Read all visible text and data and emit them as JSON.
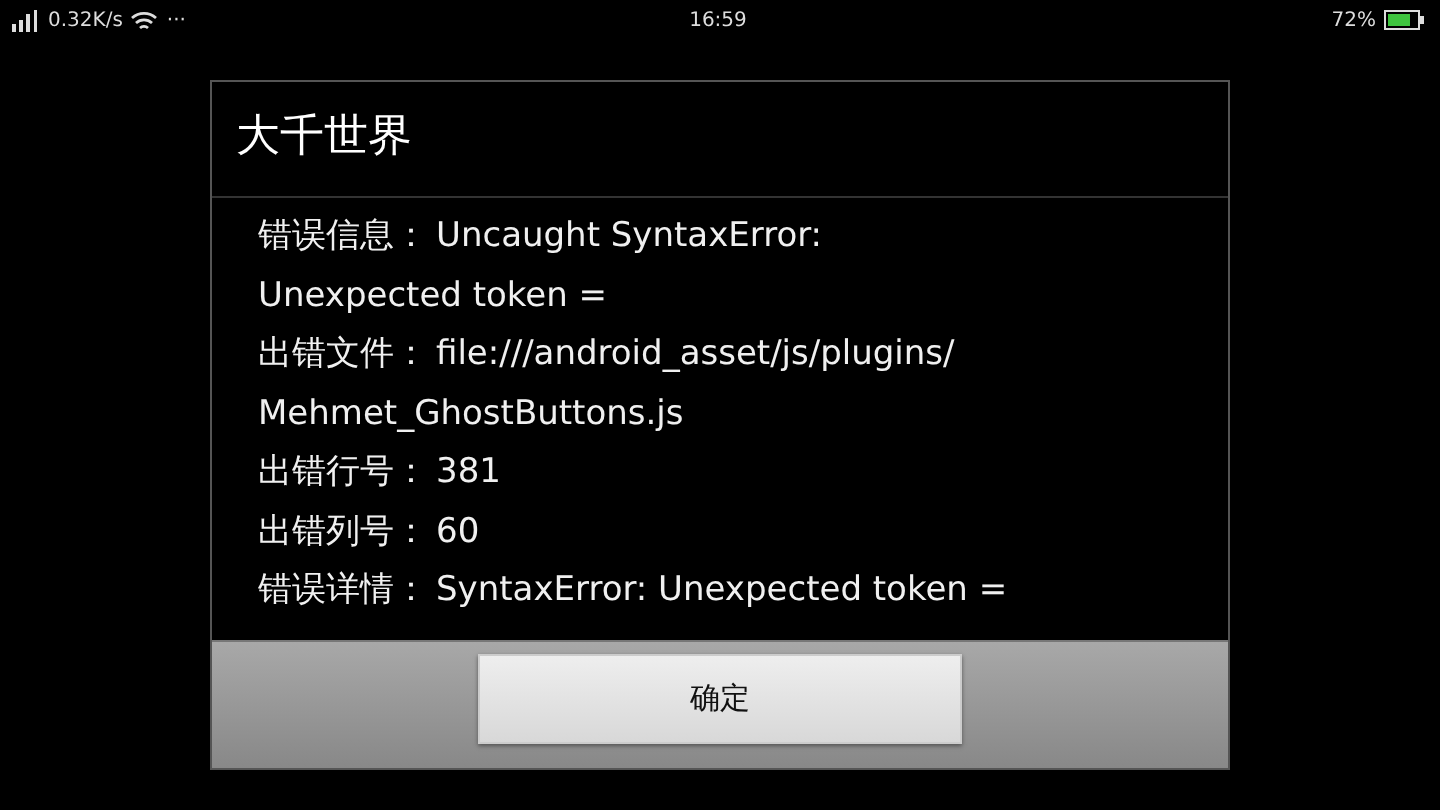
{
  "status_bar": {
    "speed": "0.32K/s",
    "more": "···",
    "time": "16:59",
    "battery": "72%"
  },
  "dialog": {
    "title": "大千世界",
    "rows": [
      {
        "label": "错误信息：",
        "lines": [
          "Uncaught SyntaxError:",
          "Unexpected token ="
        ]
      },
      {
        "label": "出错文件：",
        "lines": [
          "file:///android_asset/js/plugins/",
          "Mehmet_GhostButtons.js"
        ]
      },
      {
        "label": "出错行号：",
        "lines": [
          "381"
        ]
      },
      {
        "label": "出错列号：",
        "lines": [
          "60"
        ]
      },
      {
        "label": "错误详情：",
        "lines": [
          "SyntaxError: Unexpected token ="
        ]
      }
    ],
    "button": "确定"
  }
}
